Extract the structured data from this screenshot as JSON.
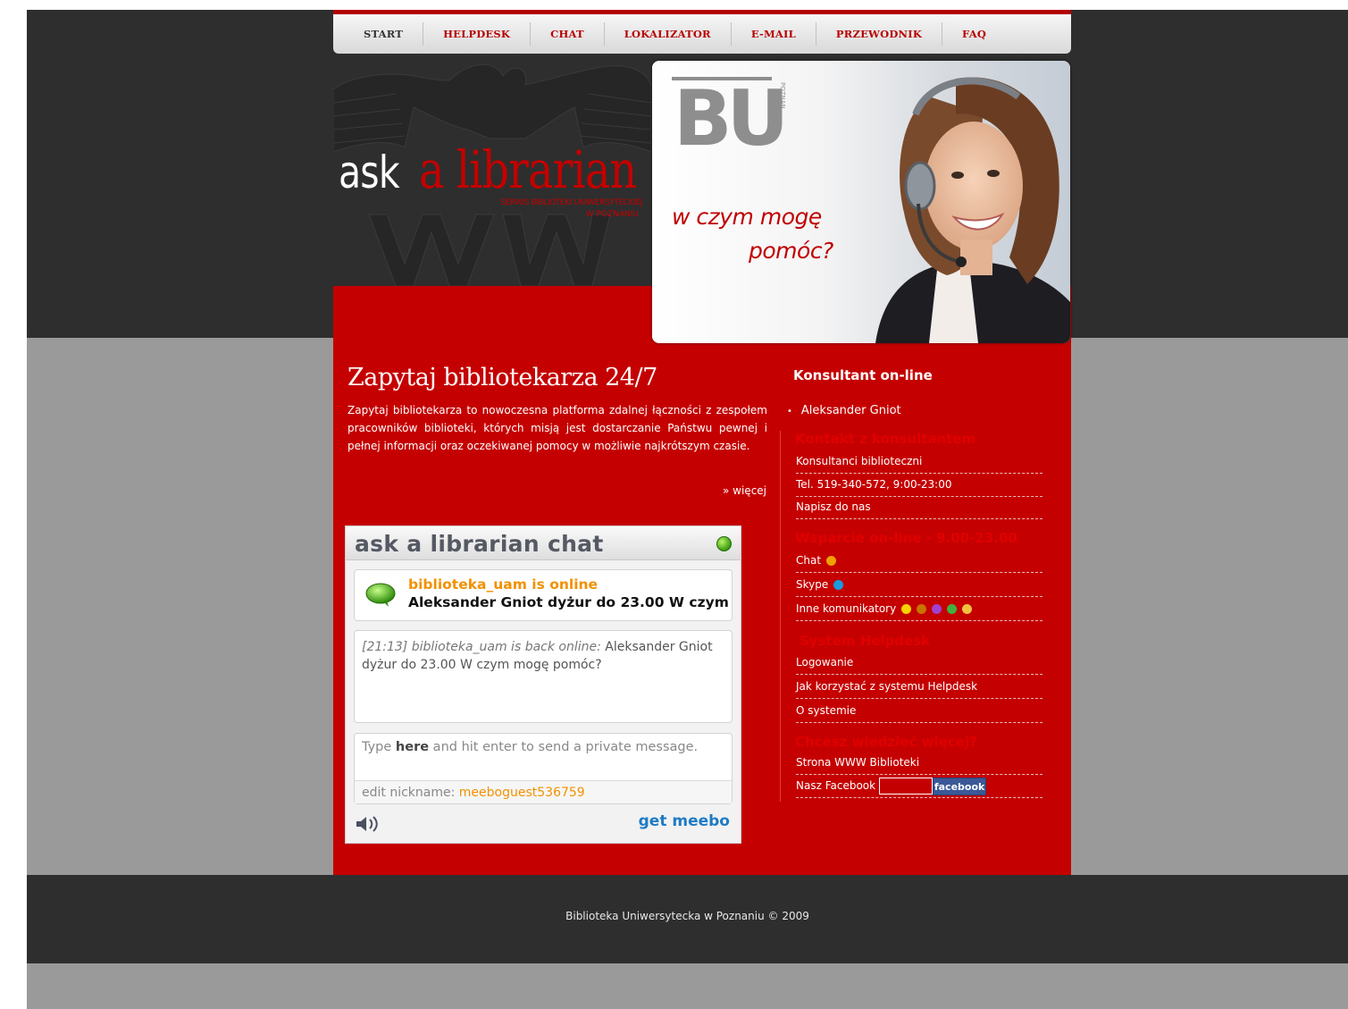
{
  "nav": [
    "START",
    "HELPDESK",
    "CHAT",
    "LOKALIZATOR",
    "E-MAIL",
    "PRZEWODNIK",
    "FAQ"
  ],
  "logo": {
    "ask": "ask",
    "librarian": "a librarian",
    "sub1": "SERWIS BIBLIOTEKI UNIWERSYTECKIEJ",
    "sub2": "W POZNANIU"
  },
  "hero": {
    "bu_letters": "BU",
    "bu_side": "POZNAŃ",
    "slogan1": "w czym mogę",
    "slogan2": "pomóc?"
  },
  "intro": {
    "title": "Zapytaj bibliotekarza 24/7",
    "text": "Zapytaj bibliotekarza to nowoczesna platforma zdalnej łączności z zespołem pracowników biblioteki, których misją jest dostarczanie Państwu pewnej i pełnej informacji oraz oczekiwanej pomocy w możliwie najkrótszym czasie.",
    "more": "» więcej"
  },
  "chat": {
    "title": "ask a librarian  chat",
    "online": "biblioteka_uam is online",
    "away_message": "Aleksander Gniot dyżur do 23.00 W czym",
    "log_meta": "[21:13] biblioteka_uam is back online:",
    "log_text": " Aleksander Gniot dyżur do 23.00 W czym mogę pomóc?",
    "input_pre": "Type ",
    "input_bold": "here",
    "input_post": " and hit enter to send a private message.",
    "nick_label": "edit nickname: ",
    "nick_value": "meeboguest536759",
    "getmeebo": "get meebo"
  },
  "sidebar": {
    "title": "Konsultant on-line",
    "consultant": "Aleksander Gniot",
    "sections": [
      {
        "head": "Kontakt z konsultantem",
        "links": [
          "Konsultanci biblioteczni",
          "Tel. 519-340-572, 9:00-23:00",
          "Napisz do nas"
        ]
      },
      {
        "head": "Wsparcie on-line - 9.00-23.00",
        "links": [
          "Chat",
          "Skype",
          "Inne komunikatory"
        ]
      },
      {
        "head": "System Helpdesk",
        "links": [
          "Logowanie",
          "Jak korzystać z systemu Helpdesk",
          "O systemie"
        ]
      },
      {
        "head": "Chcesz wiedzieć więcej?",
        "links": [
          "Strona WWW Biblioteki",
          "Nasz Facebook"
        ]
      }
    ],
    "facebook_btn": "facebook"
  },
  "footer": "Biblioteka Uniwersytecka w Poznaniu © 2009",
  "colors": {
    "red": "#c50000",
    "dark": "#2e2e2e",
    "gray": "#9a9a9a",
    "orange": "#f29100"
  }
}
